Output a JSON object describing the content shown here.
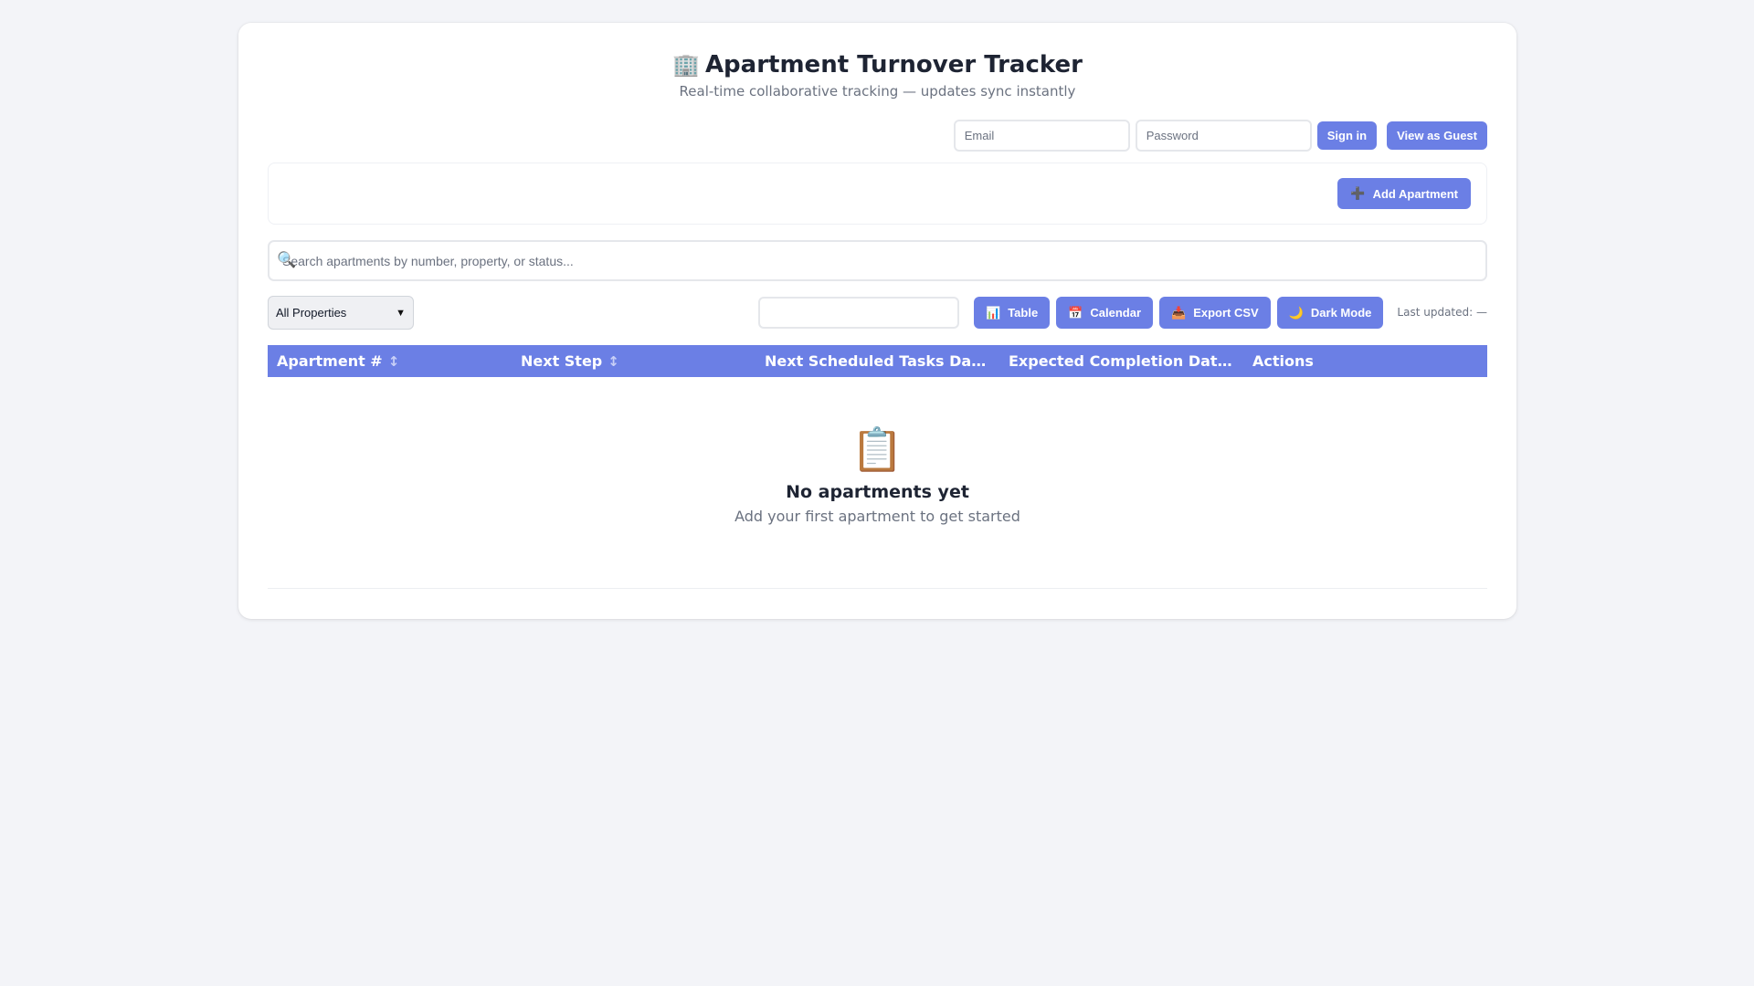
{
  "header": {
    "icon": "🏢",
    "title": "Apartment Turnover Tracker",
    "subtitle": "Real-time collaborative tracking — updates sync instantly"
  },
  "auth": {
    "email_placeholder": "Email",
    "password_placeholder": "Password",
    "signin_label": "Sign in",
    "guest_label": "View as Guest"
  },
  "toolbar": {
    "add_icon": "➕",
    "add_label": "Add Apartment"
  },
  "search": {
    "icon": "🔍",
    "placeholder": "Search apartments by number, property, or status..."
  },
  "filters": {
    "property_selected": "All Properties",
    "date_value": ""
  },
  "views": {
    "table_icon": "📊",
    "table_label": "Table",
    "calendar_icon": "📅",
    "calendar_label": "Calendar",
    "export_icon": "📥",
    "export_label": "Export CSV",
    "dark_icon": "🌙",
    "dark_label": "Dark Mode"
  },
  "status": {
    "last_updated": "Last updated: —"
  },
  "table": {
    "columns": [
      {
        "label": "Apartment #",
        "sort": "↕"
      },
      {
        "label": "Next Step",
        "sort": "↕"
      },
      {
        "label": "Next Scheduled Tasks Da…",
        "sort": ""
      },
      {
        "label": "Expected Completion Dat…",
        "sort": ""
      },
      {
        "label": "Actions",
        "sort": ""
      }
    ]
  },
  "empty_state": {
    "icon": "📋",
    "title": "No apartments yet",
    "text": "Add your first apartment to get started"
  },
  "colors": {
    "accent": "#6b7fe5",
    "background": "#f3f4f8"
  }
}
